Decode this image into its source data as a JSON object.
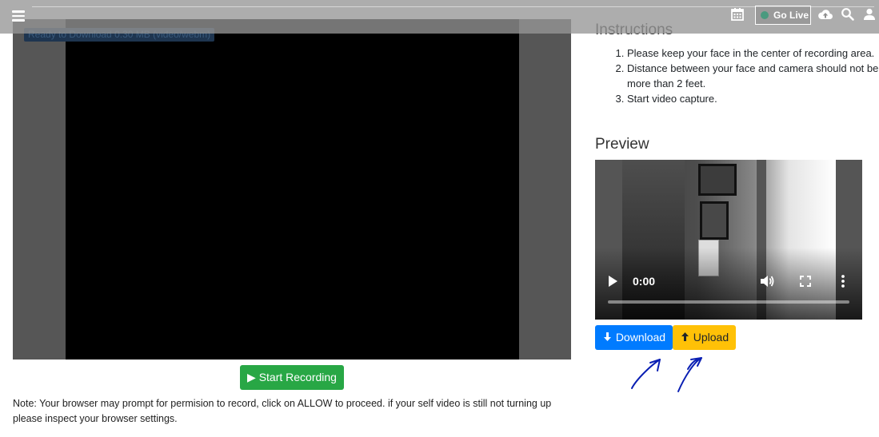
{
  "topbar": {
    "go_live_label": "Go Live",
    "icons": [
      "menu-icon",
      "calendar-icon",
      "cloud-upload-icon",
      "search-icon",
      "user-icon"
    ]
  },
  "recorder": {
    "status_badge": "Ready to Download 0.30 MB (video/webm)",
    "start_button_icon": "▶",
    "start_button_label": "Start Recording",
    "note": "Note: Your browser may prompt for permision to record, click on ALLOW to proceed. if your self video is still not turning up please inspect your browser settings."
  },
  "instructions": {
    "title": "Instructions",
    "items": [
      "Please keep your face in the center of recording area.",
      "Distance between your face and camera should not be more than 2 feet.",
      "Start video capture."
    ]
  },
  "preview": {
    "title": "Preview",
    "time": "0:00",
    "progress_fraction": 0,
    "controls": [
      "play-icon",
      "volume-icon",
      "fullscreen-icon",
      "more-options-icon"
    ]
  },
  "actions": {
    "download_label": "Download",
    "upload_label": "Upload"
  },
  "colors": {
    "start_button": "#28a745",
    "download_button": "#007bff",
    "upload_button": "#ffc107",
    "annotation": "#0a1fb3"
  }
}
